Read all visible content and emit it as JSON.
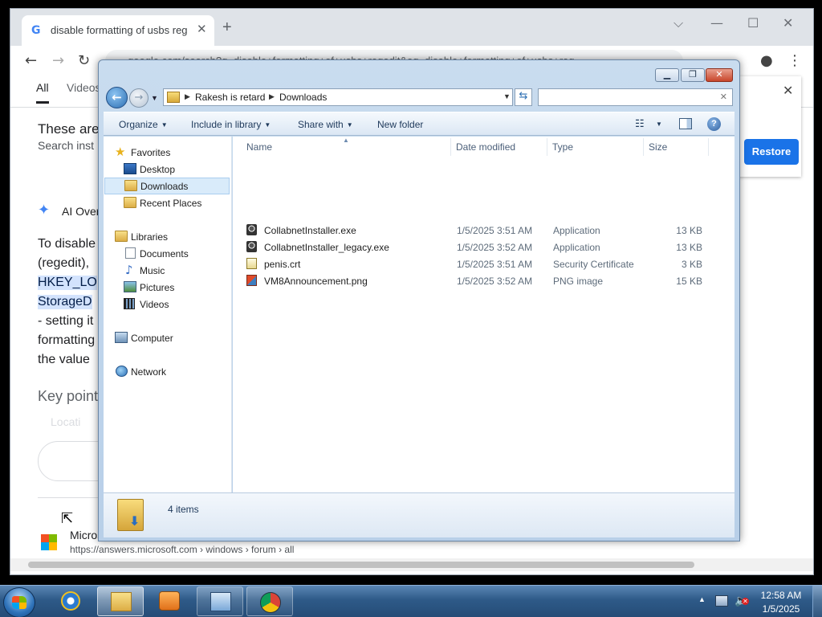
{
  "chrome": {
    "tab_title": "disable formatting of usbs regedit",
    "tab_favicon": "G",
    "omnibox_text": "google.com/search?q=disable+formatting+of+usbs+regedit&oq=disable+formatting+of+usbs+reg",
    "search_tabs": [
      "All",
      "Videos"
    ],
    "page": {
      "line1": "These are",
      "line2": "Search inst",
      "ai_label": "AI Over",
      "para": [
        {
          "text": "To disable",
          "highlight": false
        },
        {
          "text": "(regedit),",
          "highlight": false
        },
        {
          "text": "HKEY_LO",
          "highlight": true
        },
        {
          "text": "StorageD",
          "highlight": true
        },
        {
          "text": "- setting it",
          "highlight": false
        },
        {
          "text": "formatting",
          "highlight": false
        },
        {
          "text": "the value",
          "highlight": false
        }
      ],
      "key_points": "Key point",
      "bullet": "Locati",
      "result_site": "Micros",
      "result_url": "https://answers.microsoft.com › windows › forum › all"
    },
    "restore_button": "Restore"
  },
  "explorer": {
    "breadcrumb": [
      "Rakesh is retard",
      "Downloads"
    ],
    "search_placeholder": "",
    "commands": [
      "Organize",
      "Include in library",
      "Share with",
      "New folder"
    ],
    "nav": {
      "favorites_header": "Favorites",
      "favorites": [
        {
          "label": "Desktop",
          "icon": "desktop-icon",
          "selected": false
        },
        {
          "label": "Downloads",
          "icon": "downloads-folder-icon",
          "selected": true
        },
        {
          "label": "Recent Places",
          "icon": "recent-places-icon",
          "selected": false
        }
      ],
      "libraries_header": "Libraries",
      "libraries": [
        {
          "label": "Documents",
          "icon": "documents-icon"
        },
        {
          "label": "Music",
          "icon": "music-icon"
        },
        {
          "label": "Pictures",
          "icon": "pictures-icon"
        },
        {
          "label": "Videos",
          "icon": "videos-icon"
        }
      ],
      "computer": "Computer",
      "network": "Network"
    },
    "columns": {
      "name": "Name",
      "date": "Date modified",
      "type": "Type",
      "size": "Size"
    },
    "files": [
      {
        "name": "CollabnetInstaller.exe",
        "date": "1/5/2025 3:51 AM",
        "type": "Application",
        "size": "13 KB",
        "icon": "exe-icon"
      },
      {
        "name": "CollabnetInstaller_legacy.exe",
        "date": "1/5/2025 3:52 AM",
        "type": "Application",
        "size": "13 KB",
        "icon": "exe-icon"
      },
      {
        "name": "penis.crt",
        "date": "1/5/2025 3:51 AM",
        "type": "Security Certificate",
        "size": "3 KB",
        "icon": "certificate-icon"
      },
      {
        "name": "VM8Announcement.png",
        "date": "1/5/2025 3:52 AM",
        "type": "PNG image",
        "size": "15 KB",
        "icon": "png-icon"
      }
    ],
    "item_count": "4 items"
  },
  "taskbar": {
    "pinned": [
      "internet-explorer-icon",
      "windows-explorer-icon",
      "media-player-icon",
      "control-panel-icon",
      "chrome-icon"
    ],
    "time": "12:58 AM",
    "date": "1/5/2025"
  },
  "colors": {
    "explorer_frame": "#c9dcef",
    "taskbar": "#2e5a88",
    "chrome_accent": "#1a73e8",
    "highlight": "#d3e3fd"
  }
}
